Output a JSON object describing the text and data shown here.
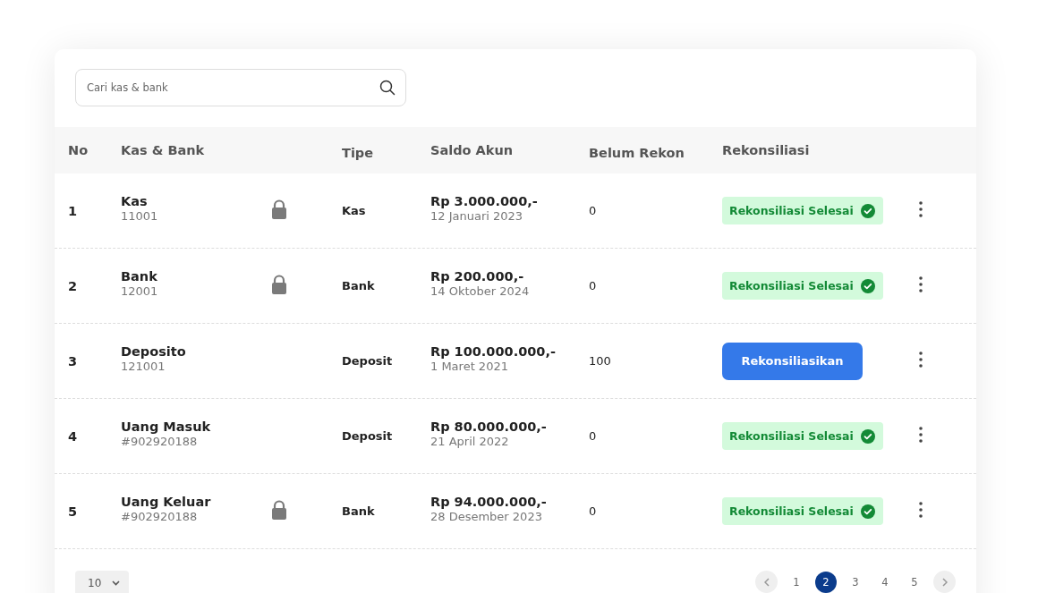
{
  "search": {
    "placeholder": "Cari kas & bank"
  },
  "table": {
    "columns": [
      "No",
      "Kas & Bank",
      "Tipe",
      "Saldo Akun",
      "Belum Rekon",
      "Rekonsiliasi"
    ],
    "rows": [
      {
        "no": "1",
        "name": "Kas",
        "code": "11001",
        "locked": true,
        "type": "Kas",
        "balance": "Rp 3.000.000,-",
        "date": "12 Januari 2023",
        "unreconciled": "0",
        "status": {
          "kind": "done",
          "label": "Rekonsiliasi Selesai"
        }
      },
      {
        "no": "2",
        "name": "Bank",
        "code": "12001",
        "locked": true,
        "type": "Bank",
        "balance": "Rp 200.000,-",
        "date": "14 Oktober 2024",
        "unreconciled": "0",
        "status": {
          "kind": "done",
          "label": "Rekonsiliasi Selesai"
        }
      },
      {
        "no": "3",
        "name": "Deposito",
        "code": "121001",
        "locked": false,
        "type": "Deposit",
        "balance": "Rp 100.000.000,-",
        "date": "1 Maret 2021",
        "unreconciled": "100",
        "status": {
          "kind": "action",
          "label": "Rekonsiliasikan"
        }
      },
      {
        "no": "4",
        "name": "Uang Masuk",
        "code": "#902920188",
        "locked": false,
        "type": "Deposit",
        "balance": "Rp 80.000.000,-",
        "date": "21 April 2022",
        "unreconciled": "0",
        "status": {
          "kind": "done",
          "label": "Rekonsiliasi Selesai"
        }
      },
      {
        "no": "5",
        "name": "Uang Keluar",
        "code": "#902920188",
        "locked": true,
        "type": "Bank",
        "balance": "Rp 94.000.000,-",
        "date": "28 Desember 2023",
        "unreconciled": "0",
        "status": {
          "kind": "done",
          "label": "Rekonsiliasi Selesai"
        }
      }
    ]
  },
  "page_size": "10",
  "pagination": [
    {
      "label": "1",
      "selected": false
    },
    {
      "label": "2",
      "selected": true
    },
    {
      "label": "3",
      "selected": false
    },
    {
      "label": "4",
      "selected": false
    },
    {
      "label": "5",
      "selected": false
    }
  ]
}
